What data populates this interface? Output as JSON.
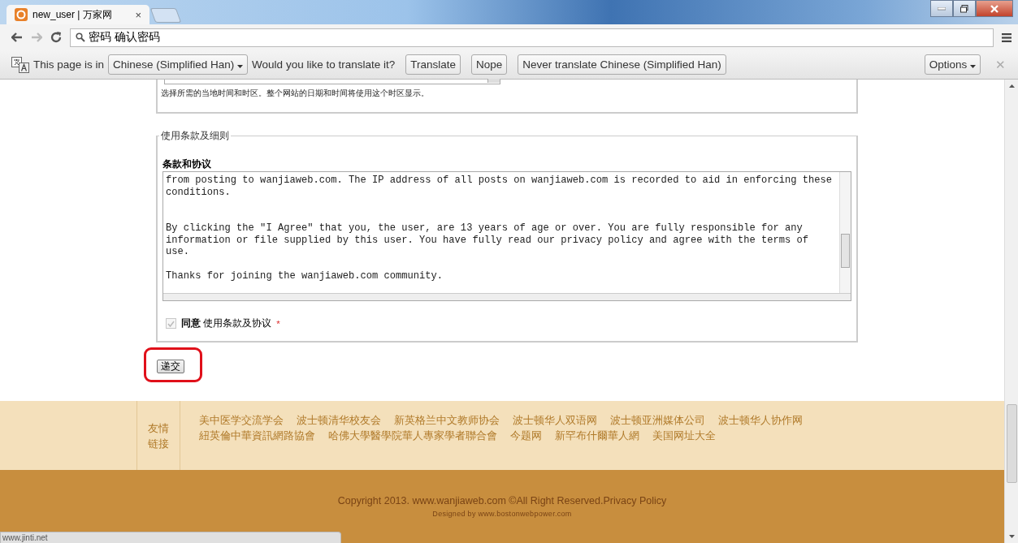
{
  "browser": {
    "tab": {
      "title": "new_user | 万家网",
      "close": "×"
    },
    "address": "密码  确认密码"
  },
  "translate_bar": {
    "prefix": "This page is in",
    "language": "Chinese (Simplified Han)",
    "question": "Would you like to translate it?",
    "buttons": [
      "Translate",
      "Nope",
      "Never translate Chinese (Simplified Han)"
    ],
    "options": "Options",
    "close": "✕"
  },
  "timezone": {
    "help": "选择所需的当地时间和时区。整个网站的日期和时间将使用这个时区显示。"
  },
  "terms": {
    "legend": "使用条款及细则",
    "heading": "条款和协议",
    "text": "from posting to wanjiaweb.com. The IP address of all posts on wanjiaweb.com is recorded to aid in enforcing these\nconditions.\n\n\nBy clicking the \"I Agree\" that you, the user, are 13 years of age or over. You are fully responsible for any\ninformation or file supplied by this user. You have fully read our privacy policy and agree with the terms of\nuse.\n\nThanks for joining the wanjiaweb.com community.",
    "agree": {
      "checked": true,
      "disabled": true,
      "label": "**同意** 使用条款及协议",
      "required": "*"
    }
  },
  "submit": {
    "label": "递交",
    "highlighted": true
  },
  "links": {
    "label": "友情链接",
    "items": [
      "美中医学交流学会",
      "波士顿清华校友会",
      "新英格兰中文教师协会",
      "波士顿华人双语网",
      "波士顿亚洲媒体公司",
      "波士顿华人协作网",
      "紐英倫中華資訊網路協會",
      "哈佛大學醫學院華人專家學者聯合會",
      "今题网",
      "新罕布什爾華人網",
      "美国网址大全"
    ]
  },
  "footer": {
    "copyright": "Copyright 2013.",
    "site_link": "www.wanjiaweb.com",
    "rights": "©All Right Reserved.",
    "privacy_link": "Privacy Policy",
    "designed": "Designed by www.bostonwebpower.com"
  },
  "status_bar": "www.jinti.net"
}
